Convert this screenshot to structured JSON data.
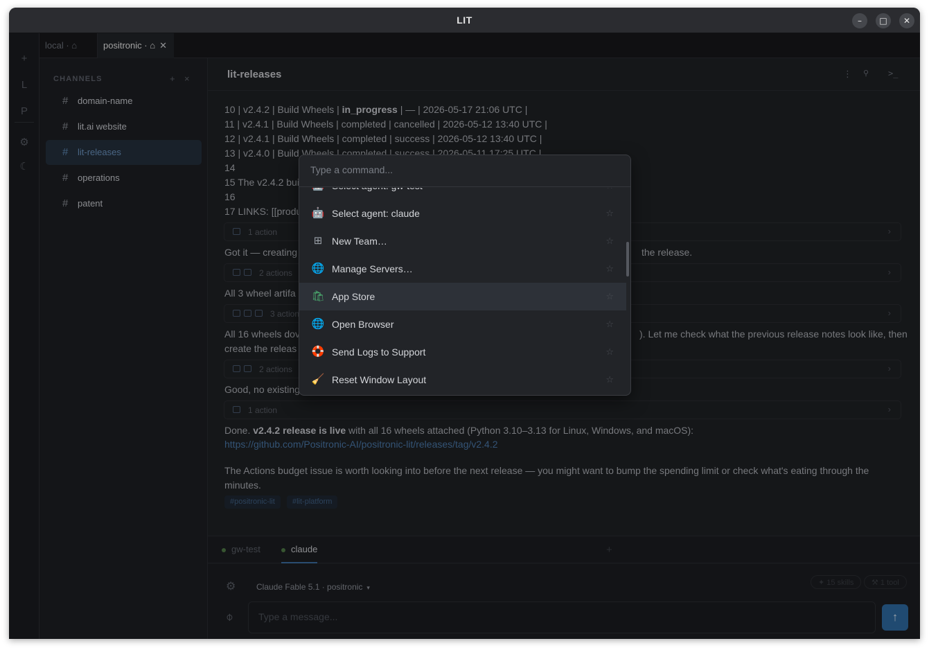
{
  "window": {
    "title": "LIT"
  },
  "controls": {
    "minimize": "–",
    "maximize": "□",
    "close": "✕"
  },
  "rail": {
    "items": [
      "+",
      "L",
      "P",
      "⚙",
      "☾"
    ]
  },
  "tabs": [
    {
      "label": "local · ⌂"
    },
    {
      "label": "positronic · ⌂",
      "close": "✕"
    }
  ],
  "sidebar": {
    "heading": "CHANNELS",
    "add": "+",
    "close": "×",
    "channels": [
      {
        "label": "domain-name"
      },
      {
        "label": "lit.ai website"
      },
      {
        "label": "lit-releases"
      },
      {
        "label": "operations"
      },
      {
        "label": "patent"
      }
    ]
  },
  "header": {
    "title": "lit-releases",
    "more": "⋮",
    "search": "🔍",
    "terminal": ">_"
  },
  "messages": {
    "l10a": "10 | v2.4.2 | Build Wheels | ",
    "l10b": "in_progress",
    "l10c": " | — | 2026-05-17 21:06 UTC |",
    "l11": "11 | v2.4.1 | Build Wheels | completed | cancelled | 2026-05-12 13:40 UTC |",
    "l12": "12 | v2.4.1 | Build Wheels | completed | success | 2026-05-12 13:40 UTC |",
    "l13": "13 | v2.4.0 | Build Wheels | completed | success | 2026-05-11 17:25 UTC |",
    "l14": "14",
    "l15": "15 The v2.4.2 bui",
    "l16": "16",
    "l17": "17 LINKS: [[produ",
    "act1": "1 action",
    "gotit_a": "Got it — creating",
    "gotit_b": "the release.",
    "act2": "2 actions",
    "all3": "All 3 wheel artifa",
    "act3": "3 actions",
    "all16_a": "All 16 wheels dov",
    "all16_b": "). Let me check what the previous release notes look like, then",
    "all16_c": "create the releas",
    "act4": "2 actions",
    "good": "Good, no existing",
    "act5": "1 action",
    "done_a": "Done. ",
    "done_b": "v2.4.2 release is live",
    "done_c": " with all 16 wheels attached (Python 3.10–3.13 for Linux, Windows, and macOS):",
    "link": "https://github.com/Positronic-AI/positronic-lit/releases/tag/v2.4.2",
    "budget1": "The Actions budget issue is worth looking into before the next release — you might want to bump the spending limit or check what's eating through the",
    "budget2": "minutes.",
    "tags": [
      "#positronic-lit",
      "#lit-platform"
    ]
  },
  "agent_tabs": [
    {
      "label": "gw-test"
    },
    {
      "label": "claude"
    }
  ],
  "agent_add": "+",
  "composer": {
    "model": "Claude Fable 5.1 · positronic",
    "skills": "✦ 15 skills",
    "tools": "⚒ 1 tool",
    "placeholder": "Type a message...",
    "send": "↑"
  },
  "palette": {
    "placeholder": "Type a command...",
    "items": [
      {
        "label": "Select agent: gw-test",
        "icon": "robot-icon"
      },
      {
        "label": "Select agent: claude",
        "icon": "robot-icon"
      },
      {
        "label": "New Team…",
        "icon": "grid-icon"
      },
      {
        "label": "Manage Servers…",
        "icon": "globe-icon"
      },
      {
        "label": "App Store",
        "icon": "shopping-bag-icon"
      },
      {
        "label": "Open Browser",
        "icon": "globe-icon"
      },
      {
        "label": "Send Logs to Support",
        "icon": "lifebuoy-icon"
      },
      {
        "label": "Reset Window Layout",
        "icon": "broom-icon"
      }
    ]
  }
}
